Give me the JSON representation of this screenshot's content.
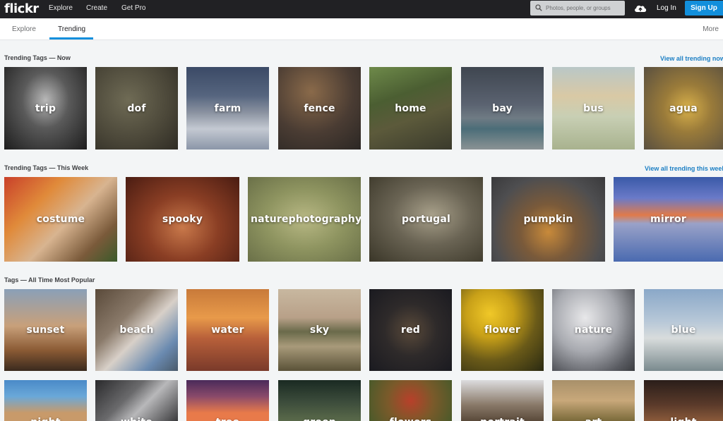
{
  "topbar": {
    "logo": "flickr",
    "nav": [
      "Explore",
      "Create",
      "Get Pro"
    ],
    "search_placeholder": "Photos, people, or groups",
    "login": "Log In",
    "signup": "Sign Up"
  },
  "subnav": {
    "tabs": [
      "Explore",
      "Trending"
    ],
    "active": "Trending",
    "more": "More"
  },
  "sections": [
    {
      "title": "Trending Tags — Now",
      "view_all": "View all trending now",
      "tiles": [
        {
          "label": "trip"
        },
        {
          "label": "dof"
        },
        {
          "label": "farm"
        },
        {
          "label": "fence"
        },
        {
          "label": "home"
        },
        {
          "label": "bay"
        },
        {
          "label": "bus"
        },
        {
          "label": "agua"
        }
      ]
    },
    {
      "title": "Trending Tags — This Week",
      "view_all": "View all trending this week",
      "tiles": [
        {
          "label": "costume"
        },
        {
          "label": "spooky"
        },
        {
          "label": "naturephotography"
        },
        {
          "label": "portugal"
        },
        {
          "label": "pumpkin"
        },
        {
          "label": "mirror"
        }
      ]
    },
    {
      "title": "Tags — All Time Most Popular",
      "tiles": [
        {
          "label": "sunset"
        },
        {
          "label": "beach"
        },
        {
          "label": "water"
        },
        {
          "label": "sky"
        },
        {
          "label": "red"
        },
        {
          "label": "flower"
        },
        {
          "label": "nature"
        },
        {
          "label": "blue"
        }
      ]
    },
    {
      "tiles": [
        {
          "label": "night"
        },
        {
          "label": "white"
        },
        {
          "label": "tree"
        },
        {
          "label": "green"
        },
        {
          "label": "flowers"
        },
        {
          "label": "portrait"
        },
        {
          "label": "art"
        },
        {
          "label": "light"
        }
      ]
    }
  ],
  "colors": {
    "topbar": "#212124",
    "accent": "#128fdc",
    "link": "#1c7fc4",
    "background": "#f3f5f6"
  }
}
